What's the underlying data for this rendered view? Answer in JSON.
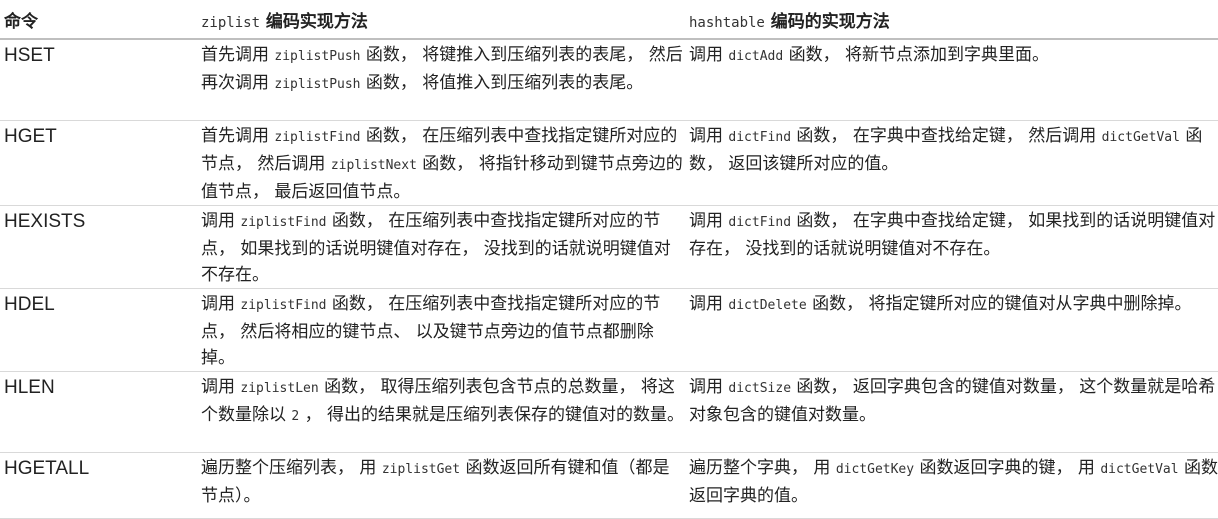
{
  "headers": {
    "command": "命令",
    "ziplist_code": "ziplist",
    "ziplist_text": " 编码实现方法",
    "hashtable_code": "hashtable",
    "hashtable_text": " 编码的实现方法"
  },
  "rows": [
    {
      "command": "HSET",
      "ziplist": [
        {
          "t": "首先调用 "
        },
        {
          "c": "ziplistPush"
        },
        {
          "t": " 函数， 将键推入到压缩列表的表尾， 然后再次调用 "
        },
        {
          "c": "ziplistPush"
        },
        {
          "t": " 函数， 将值推入到压缩列表的表尾。"
        }
      ],
      "hashtable": [
        {
          "t": "调用 "
        },
        {
          "c": "dictAdd"
        },
        {
          "t": " 函数， 将新节点添加到字典里面。"
        }
      ]
    },
    {
      "command": "HGET",
      "ziplist": [
        {
          "t": "首先调用 "
        },
        {
          "c": "ziplistFind"
        },
        {
          "t": " 函数， 在压缩列表中查找指定键所对应的节点， 然后调用 "
        },
        {
          "c": "ziplistNext"
        },
        {
          "t": " 函数， 将指针移动到键节点旁边的值节点， 最后返回值节点。"
        }
      ],
      "hashtable": [
        {
          "t": "调用 "
        },
        {
          "c": "dictFind"
        },
        {
          "t": " 函数， 在字典中查找给定键， 然后调用 "
        },
        {
          "c": "dictGetVal"
        },
        {
          "t": " 函数， 返回该键所对应的值。"
        }
      ]
    },
    {
      "command": "HEXISTS",
      "ziplist": [
        {
          "t": "调用 "
        },
        {
          "c": "ziplistFind"
        },
        {
          "t": " 函数， 在压缩列表中查找指定键所对应的节点， 如果找到的话说明键值对存在， 没找到的话就说明键值对不存在。"
        }
      ],
      "hashtable": [
        {
          "t": "调用 "
        },
        {
          "c": "dictFind"
        },
        {
          "t": " 函数， 在字典中查找给定键， 如果找到的话说明键值对存在， 没找到的话就说明键值对不存在。"
        }
      ]
    },
    {
      "command": "HDEL",
      "ziplist": [
        {
          "t": "调用 "
        },
        {
          "c": "ziplistFind"
        },
        {
          "t": " 函数， 在压缩列表中查找指定键所对应的节点， 然后将相应的键节点、 以及键节点旁边的值节点都删除掉。"
        }
      ],
      "hashtable": [
        {
          "t": "调用 "
        },
        {
          "c": "dictDelete"
        },
        {
          "t": " 函数， 将指定键所对应的键值对从字典中删除掉。"
        }
      ]
    },
    {
      "command": "HLEN",
      "ziplist": [
        {
          "t": "调用 "
        },
        {
          "c": "ziplistLen"
        },
        {
          "t": " 函数， 取得压缩列表包含节点的总数量， 将这个数量除以 "
        },
        {
          "c": "2"
        },
        {
          "t": " ， 得出的结果就是压缩列表保存的键值对的数量。"
        }
      ],
      "hashtable": [
        {
          "t": "调用 "
        },
        {
          "c": "dictSize"
        },
        {
          "t": " 函数， 返回字典包含的键值对数量， 这个数量就是哈希对象包含的键值对数量。"
        }
      ]
    },
    {
      "command": "HGETALL",
      "ziplist": [
        {
          "t": "遍历整个压缩列表， 用 "
        },
        {
          "c": "ziplistGet"
        },
        {
          "t": " 函数返回所有键和值（都是节点）。"
        }
      ],
      "hashtable": [
        {
          "t": "遍历整个字典， 用 "
        },
        {
          "c": "dictGetKey"
        },
        {
          "t": " 函数返回字典的键， 用 "
        },
        {
          "c": "dictGetVal"
        },
        {
          "t": " 函数返回字典的值。"
        }
      ]
    }
  ]
}
